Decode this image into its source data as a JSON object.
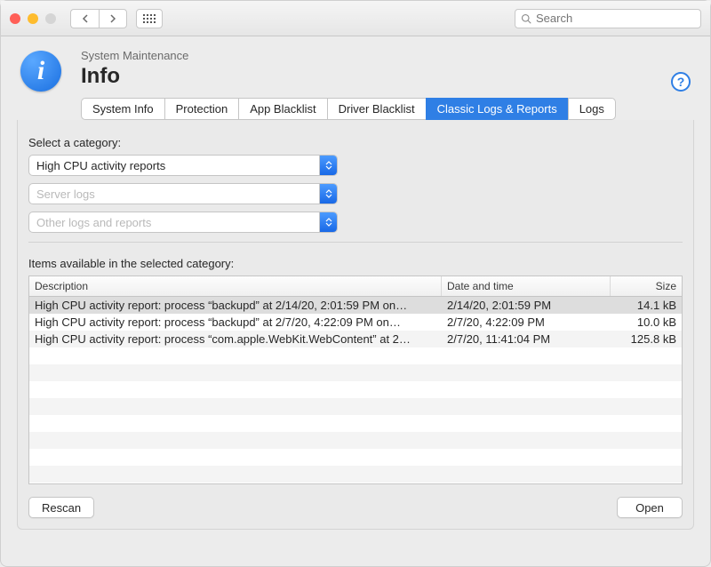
{
  "toolbar": {
    "search_placeholder": "Search"
  },
  "header": {
    "subtitle": "System Maintenance",
    "title": "Info"
  },
  "tabs": [
    {
      "label": "System Info"
    },
    {
      "label": "Protection"
    },
    {
      "label": "App Blacklist"
    },
    {
      "label": "Driver Blacklist"
    },
    {
      "label": "Classic Logs & Reports",
      "active": true
    },
    {
      "label": "Logs"
    }
  ],
  "category": {
    "prompt": "Select a category:",
    "selected": "High CPU activity reports",
    "secondary1": "Server logs",
    "secondary2": "Other logs and reports"
  },
  "items_label": "Items available in the selected category:",
  "columns": {
    "description": "Description",
    "datetime": "Date and time",
    "size": "Size"
  },
  "rows": [
    {
      "description": "High CPU activity report: process “backupd” at 2/14/20, 2:01:59 PM on…",
      "datetime": "2/14/20, 2:01:59 PM",
      "size": "14.1 kB",
      "selected": true
    },
    {
      "description": "High CPU activity report: process “backupd” at 2/7/20, 4:22:09 PM on…",
      "datetime": "2/7/20, 4:22:09 PM",
      "size": "10.0 kB"
    },
    {
      "description": "High CPU activity report: process “com.apple.WebKit.WebContent” at 2…",
      "datetime": "2/7/20, 11:41:04 PM",
      "size": "125.8 kB"
    }
  ],
  "buttons": {
    "rescan": "Rescan",
    "open": "Open"
  }
}
